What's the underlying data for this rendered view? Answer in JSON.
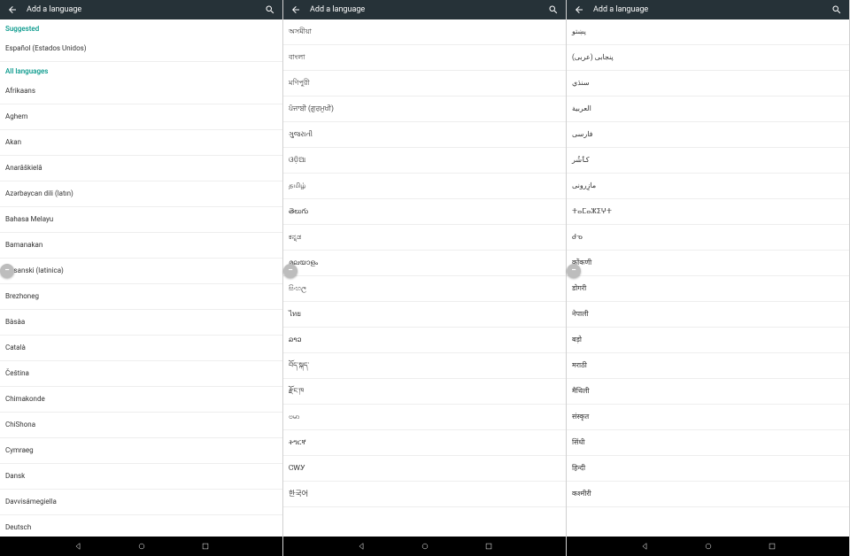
{
  "panels": [
    {
      "title": "Add a language",
      "fab": true,
      "sections": [
        {
          "header": "Suggested",
          "items": [
            "Español (Estados Unidos)"
          ]
        },
        {
          "header": "All languages",
          "items": [
            "Afrikaans",
            "Aghem",
            "Akan",
            "Anarâškielâ",
            "Azərbaycan dili (latın)",
            "Bahasa Melayu",
            "Bamanakan",
            "Bosanski (latinica)",
            "Brezhoneg",
            "Bàsàa",
            "Català",
            "Čeština",
            "Chimakonde",
            "ChiShona",
            "Cymraeg",
            "Dansk",
            "Davvisámegiella",
            "Deutsch"
          ]
        }
      ]
    },
    {
      "title": "Add a language",
      "fab": true,
      "sections": [
        {
          "header": null,
          "items": [
            "অসমীয়া",
            "বাংলা",
            "মণিপুরী",
            "ਪੰਜਾਬੀ (ਗੁਰਮੁਖੀ)",
            "ગુજરાતી",
            "ଓଡ଼ିଆ",
            "தமிழ்",
            "తెలుగు",
            "ಕನ್ನಡ",
            "മലയാളം",
            "සිංහල",
            "ไทย",
            "ລາວ",
            "བོད་སྐད་",
            "རྫོང་ཁ",
            "ဗမာ",
            "ትግርኛ",
            "ᏣᎳᎩ",
            "한국어"
          ]
        }
      ]
    },
    {
      "title": "Add a language",
      "fab": true,
      "sections": [
        {
          "header": null,
          "items": [
            "پښتو",
            "پنجابی (عربی)",
            "سنڌي",
            "العربية",
            "فارسی",
            "کٲشُر",
            "مازِرونی",
            "ⵜⴰⵎⴰⵣⵉⵖⵜ",
            "ᑯᓀ",
            "कोंकणी",
            "डोगरी",
            "नेपाली",
            "बड़ो",
            "मराठी",
            "मैथिली",
            "संस्कृत",
            "सिंधी",
            "हिन्दी",
            "कश्मीरी"
          ]
        }
      ]
    }
  ]
}
